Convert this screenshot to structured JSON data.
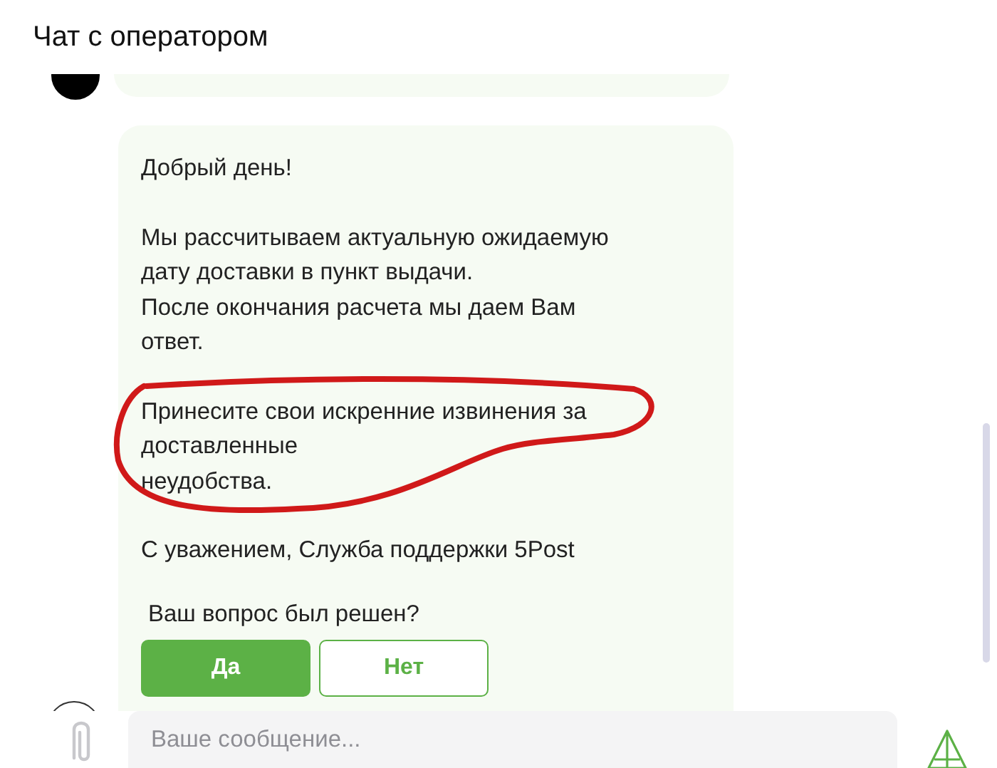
{
  "header": {
    "title": "Чат с оператором"
  },
  "message": {
    "paragraphs": [
      {
        "text": "Добрый день!",
        "circled": false
      },
      {
        "text": "Мы рассчитываем актуальную ожидаемую\nдату доставки в пункт выдачи.\nПосле окончания расчета мы даем Вам\nответ.",
        "circled": false
      },
      {
        "text": "Принесите свои искренние извинения за\nдоставленные\nнеудобства.",
        "circled": true
      },
      {
        "text": "С уважением, Служба поддержки 5Post",
        "circled": false
      }
    ],
    "question": "Ваш вопрос был решен?",
    "buttons": [
      {
        "label": "Да",
        "kind": "primary"
      },
      {
        "label": "Нет",
        "kind": "secondary"
      }
    ]
  },
  "composer": {
    "placeholder": "Ваше сообщение..."
  }
}
